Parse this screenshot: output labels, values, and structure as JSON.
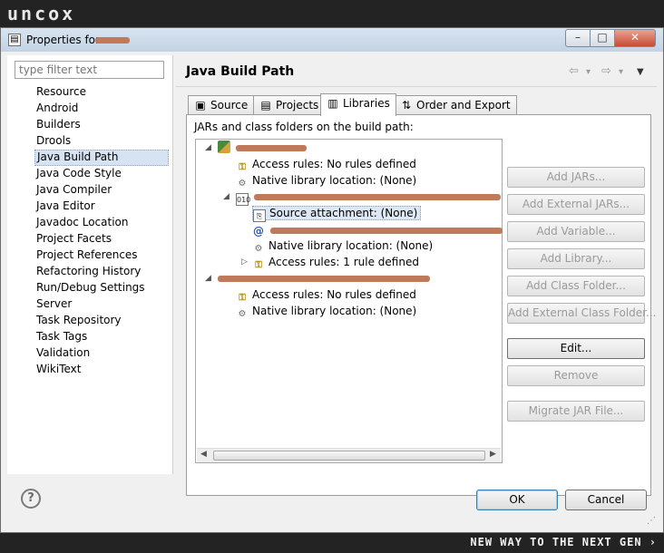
{
  "banner": {
    "logo": "uncox",
    "tagline": "NEW WAY TO THE NEXT GEN ›"
  },
  "window": {
    "title": "Properties for",
    "title_icon": "properties-icon",
    "controls": {
      "minimize": "–",
      "maximize": "□",
      "close": "✕"
    }
  },
  "filter": {
    "placeholder": "type filter text"
  },
  "nav": {
    "items": [
      "Resource",
      "Android",
      "Builders",
      "Drools",
      "Java Build Path",
      "Java Code Style",
      "Java Compiler",
      "Java Editor",
      "Javadoc Location",
      "Project Facets",
      "Project References",
      "Refactoring History",
      "Run/Debug Settings",
      "Server",
      "Task Repository",
      "Task Tags",
      "Validation",
      "WikiText"
    ],
    "selected": "Java Build Path"
  },
  "page": {
    "title": "Java Build Path"
  },
  "history": {
    "back": "⇦",
    "forward": "⇨",
    "dropdown": "▾",
    "menu": "▼"
  },
  "tabs": [
    {
      "label": "Source",
      "icon": "source-folder-icon"
    },
    {
      "label": "Projects",
      "icon": "projects-icon"
    },
    {
      "label": "Libraries",
      "icon": "libraries-icon",
      "active": true
    },
    {
      "label": "Order and Export",
      "icon": "order-export-icon"
    }
  ],
  "panel": {
    "label": "JARs and class folders on the build path:"
  },
  "tree": {
    "lib1": {
      "access": "Access rules: No rules defined",
      "native": "Native library location: (None)"
    },
    "jar": {
      "source": "Source attachment: (None)",
      "native": "Native library location: (None)",
      "access": "Access rules: 1 rule defined"
    },
    "lib2": {
      "access": "Access rules: No rules defined",
      "native": "Native library location: (None)"
    }
  },
  "buttons": {
    "add_jars": "Add JARs...",
    "add_external_jars": "Add External JARs...",
    "add_variable": "Add Variable...",
    "add_library": "Add Library...",
    "add_class_folder": "Add Class Folder...",
    "add_external_class_folder": "Add External Class Folder...",
    "edit": "Edit...",
    "remove": "Remove",
    "migrate": "Migrate JAR File..."
  },
  "dialog": {
    "ok": "OK",
    "cancel": "Cancel",
    "help": "?"
  }
}
